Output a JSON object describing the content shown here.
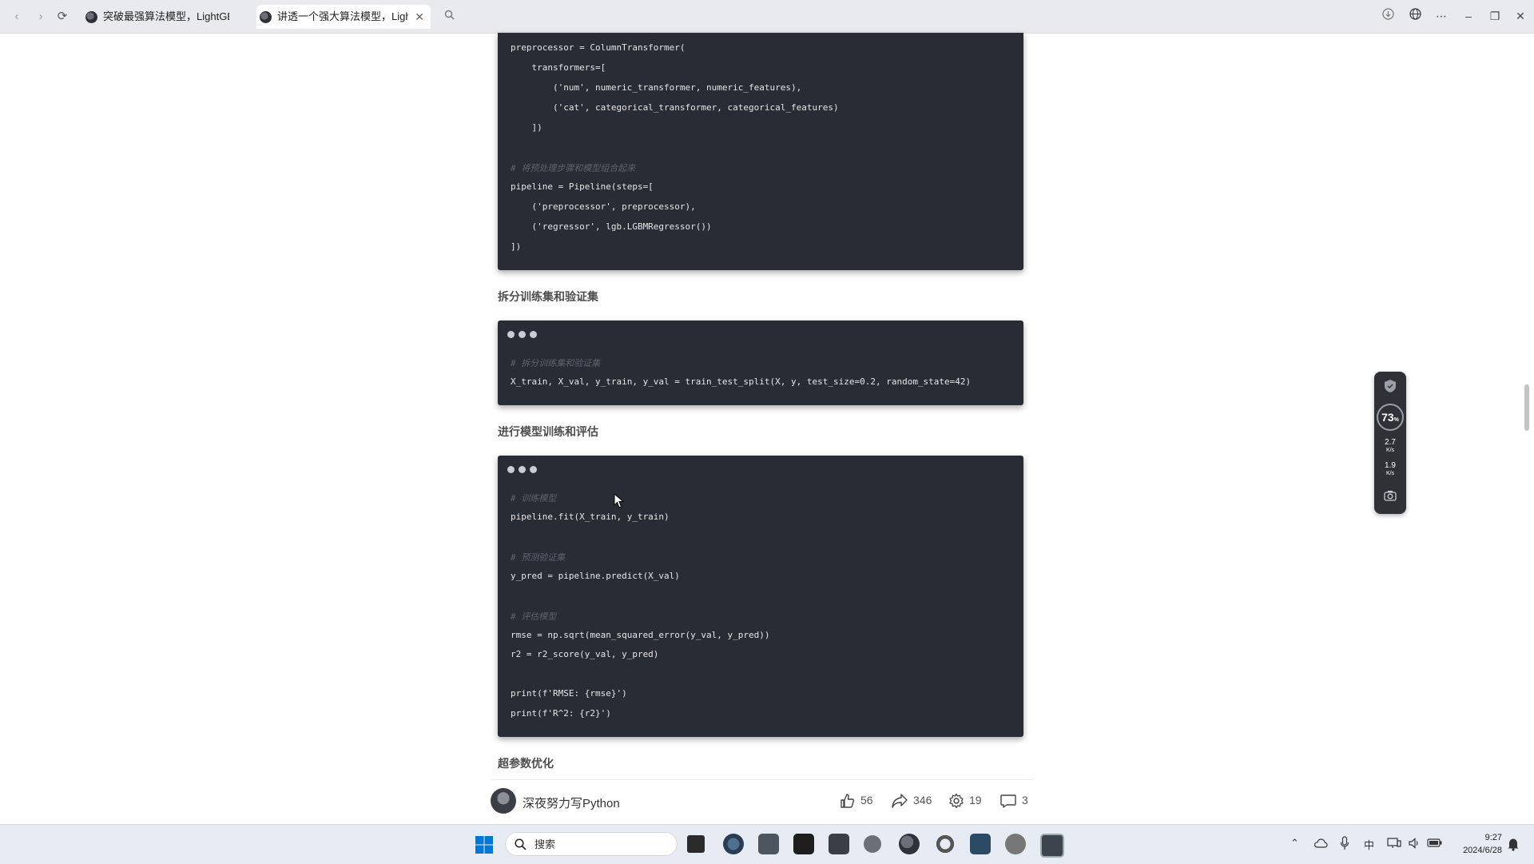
{
  "browser": {
    "tabs": [
      {
        "title": "突破最强算法模型，LightGBM !",
        "active": false
      },
      {
        "title": "讲透一个强大算法模型，Ligh",
        "active": true
      }
    ]
  },
  "article": {
    "code_block_1": {
      "lines": [
        {
          "text": "preprocessor = ColumnTransformer(",
          "comment": false
        },
        {
          "text": "    transformers=[",
          "comment": false
        },
        {
          "text": "        ('num', numeric_transformer, numeric_features),",
          "comment": false
        },
        {
          "text": "        ('cat', categorical_transformer, categorical_features)",
          "comment": false
        },
        {
          "text": "    ])",
          "comment": false
        },
        {
          "text": "",
          "comment": false
        },
        {
          "text": "# 将预处理步骤和模型组合起来",
          "comment": true
        },
        {
          "text": "pipeline = Pipeline(steps=[",
          "comment": false
        },
        {
          "text": "    ('preprocessor', preprocessor),",
          "comment": false
        },
        {
          "text": "    ('regressor', lgb.LGBMRegressor())",
          "comment": false
        },
        {
          "text": "])",
          "comment": false
        }
      ]
    },
    "section_split": "拆分训练集和验证集",
    "code_block_2": {
      "lines": [
        {
          "text": "# 拆分训练集和验证集",
          "comment": true
        },
        {
          "text": "X_train, X_val, y_train, y_val = train_test_split(X, y, test_size=0.2, random_state=42)",
          "comment": false
        }
      ]
    },
    "section_train": "进行模型训练和评估",
    "code_block_3": {
      "lines": [
        {
          "text": "# 训练模型",
          "comment": true
        },
        {
          "text": "pipeline.fit(X_train, y_train)",
          "comment": false
        },
        {
          "text": "",
          "comment": false
        },
        {
          "text": "# 预测验证集",
          "comment": true
        },
        {
          "text": "y_pred = pipeline.predict(X_val)",
          "comment": false
        },
        {
          "text": "",
          "comment": false
        },
        {
          "text": "# 评估模型",
          "comment": true
        },
        {
          "text": "rmse = np.sqrt(mean_squared_error(y_val, y_pred))",
          "comment": false
        },
        {
          "text": "r2 = r2_score(y_val, y_pred)",
          "comment": false
        },
        {
          "text": "",
          "comment": false
        },
        {
          "text": "print(f'RMSE: {rmse}')",
          "comment": false
        },
        {
          "text": "print(f'R^2: {r2}')",
          "comment": false
        }
      ]
    },
    "section_tuning": "超参数优化"
  },
  "author_bar": {
    "author": "深夜努力写Python",
    "likes": "56",
    "shares": "346",
    "favorites": "19",
    "comments": "3"
  },
  "widget": {
    "percent": "73",
    "percent_unit": "%",
    "upload_speed": "2.7",
    "download_speed": "1.9",
    "speed_unit": "K/s"
  },
  "taskbar": {
    "search_placeholder": "搜索",
    "ime": "中",
    "time": "9:27",
    "date": "2024/6/28"
  },
  "colors": {
    "code_bg": "#282c34",
    "comment": "#5c6370",
    "taskbar_bg": "#e7ebf3"
  }
}
